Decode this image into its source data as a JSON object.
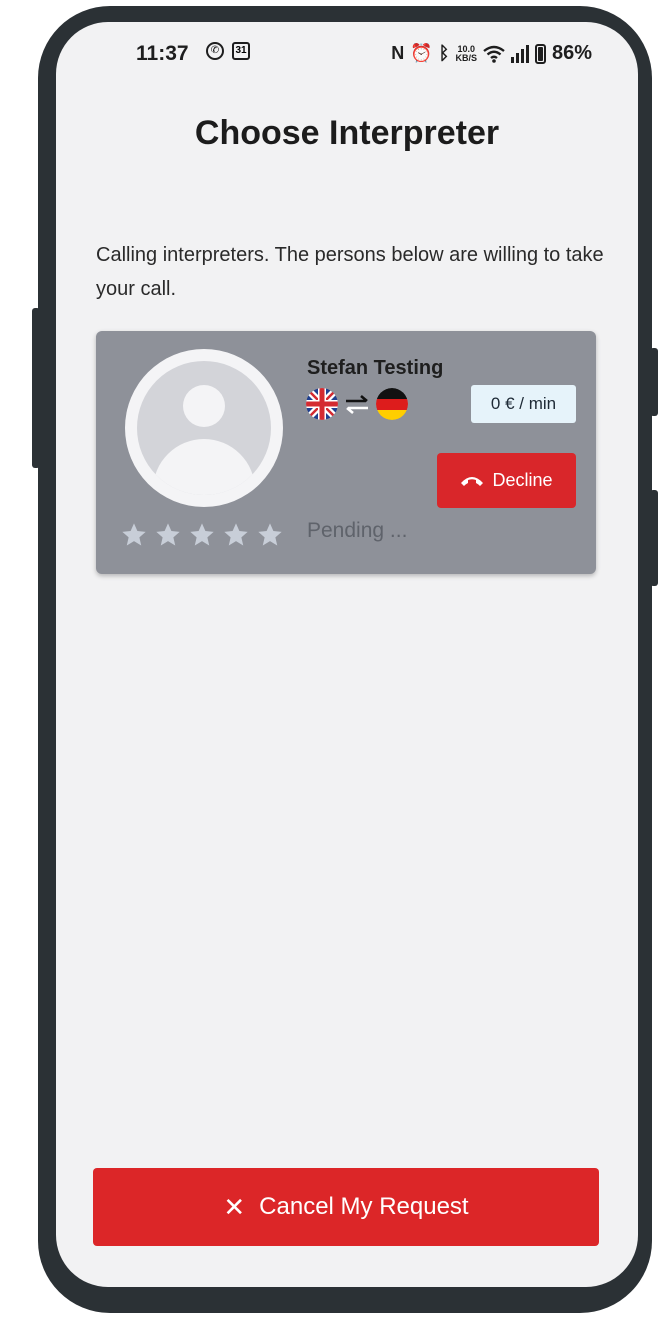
{
  "status_bar": {
    "time": "11:37",
    "calendar_day": "31",
    "network_speed_value": "10.0",
    "network_speed_unit": "KB/S",
    "battery": "86%"
  },
  "header": {
    "title": "Choose Interpreter"
  },
  "intro_text": "Calling interpreters. The persons below are willing to take your call.",
  "interpreter_card": {
    "name": "Stefan Testing",
    "from_language_icon": "uk-flag-icon",
    "to_language_icon": "germany-flag-icon",
    "price": "0 € / min",
    "decline_label": "Decline",
    "rating": 5,
    "status": "Pending ..."
  },
  "footer": {
    "cancel_label": "Cancel My Request"
  },
  "colors": {
    "screen_background": "#f2f2f3",
    "card_background": "#8e9199",
    "accent_red": "#dc2628",
    "price_badge": "#e6f3fa"
  }
}
